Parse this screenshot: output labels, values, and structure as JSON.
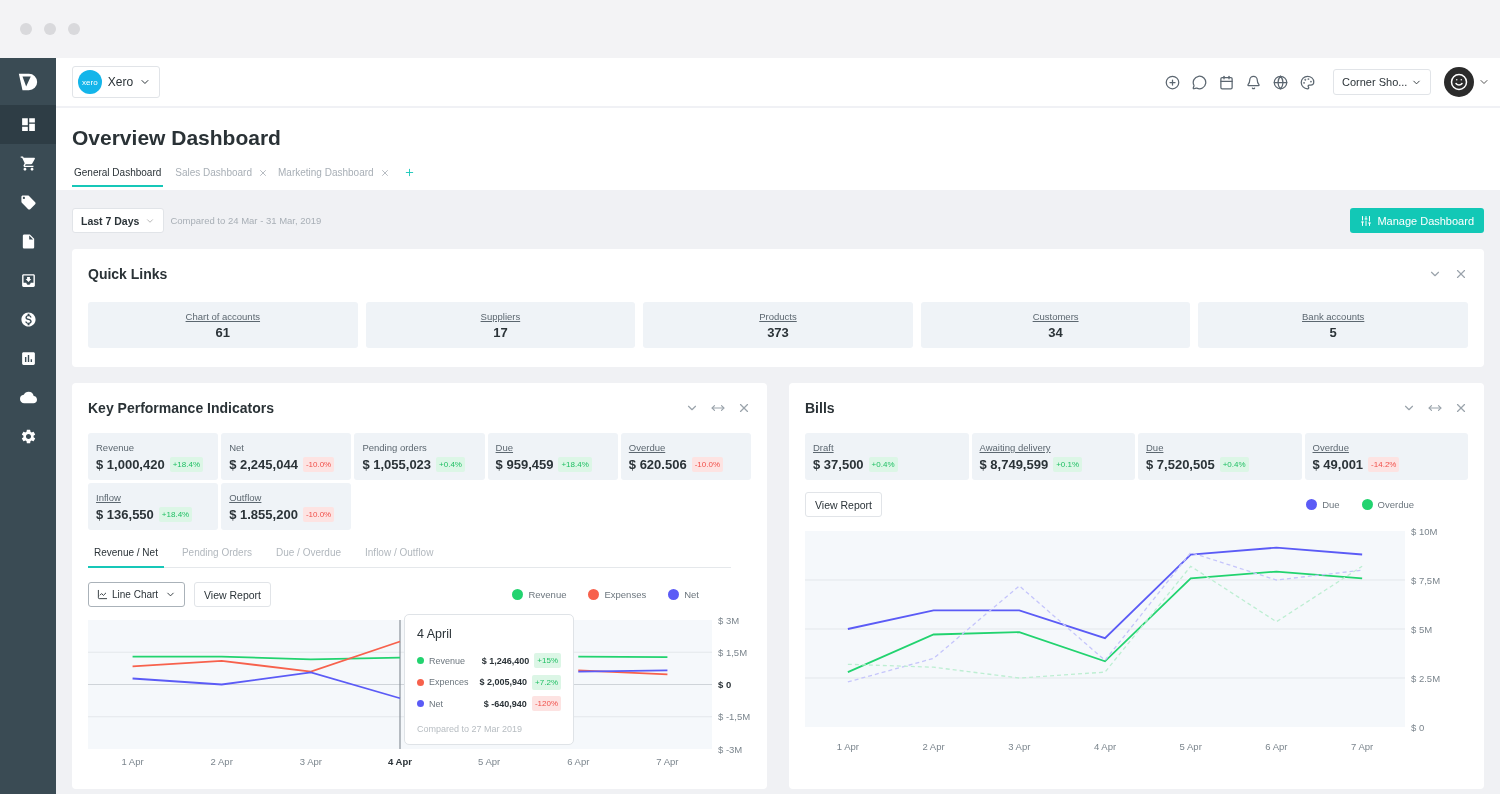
{
  "sidebar": {
    "items": [
      {
        "kind": "dashboard",
        "selected": true
      },
      {
        "kind": "cart",
        "selected": false
      },
      {
        "kind": "tag",
        "selected": false
      },
      {
        "kind": "file",
        "selected": false
      },
      {
        "kind": "inbox",
        "selected": false
      },
      {
        "kind": "money",
        "selected": false
      },
      {
        "kind": "report",
        "selected": false
      },
      {
        "kind": "cloud",
        "selected": false
      },
      {
        "kind": "settings",
        "selected": false
      }
    ]
  },
  "topbar": {
    "org": {
      "logo": "xero",
      "name": "Xero"
    },
    "shop": "Corner Sho..."
  },
  "page": {
    "title": "Overview Dashboard",
    "tabs": [
      {
        "label": "General Dashboard",
        "selected": true,
        "closable": false
      },
      {
        "label": "Sales Dashboard",
        "selected": false,
        "closable": true
      },
      {
        "label": "Marketing Dashboard",
        "selected": false,
        "closable": true
      }
    ]
  },
  "filter": {
    "period": "Last 7 Days",
    "compared": "Compared to 24 Mar - 31 Mar, 2019",
    "action": "Manage Dashboard"
  },
  "quick_links": {
    "title": "Quick Links",
    "items": [
      {
        "label": "Chart of accounts",
        "value": "61"
      },
      {
        "label": "Suppliers",
        "value": "17"
      },
      {
        "label": "Products",
        "value": "373"
      },
      {
        "label": "Customers",
        "value": "34"
      },
      {
        "label": "Bank accounts",
        "value": "5"
      }
    ]
  },
  "kpi": {
    "title": "Key Performance Indicators",
    "stats": [
      {
        "label": "Revenue",
        "link": false,
        "value": "$ 1,000,420",
        "change": "+18.4%",
        "positive": true
      },
      {
        "label": "Net",
        "link": false,
        "value": "$ 2,245,044",
        "change": "-10.0%",
        "positive": false
      },
      {
        "label": "Pending orders",
        "link": false,
        "value": "$ 1,055,023",
        "change": "+0.4%",
        "positive": true
      },
      {
        "label": "Due",
        "link": true,
        "value": "$ 959,459",
        "change": "+18.4%",
        "positive": true
      },
      {
        "label": "Overdue",
        "link": true,
        "value": "$ 620.506",
        "change": "-10.0%",
        "positive": false
      },
      {
        "label": "Inflow",
        "link": true,
        "value": "$ 136,550",
        "change": "+18.4%",
        "positive": true
      },
      {
        "label": "Outflow",
        "link": true,
        "value": "$ 1.855,200",
        "change": "-10.0%",
        "positive": false
      }
    ],
    "tabs": [
      {
        "label": "Revenue / Net",
        "selected": true
      },
      {
        "label": "Pending Orders",
        "selected": false
      },
      {
        "label": "Due / Overdue",
        "selected": false
      },
      {
        "label": "Inflow / Outflow",
        "selected": false
      }
    ],
    "chart_type": "Line Chart",
    "report": "View Report",
    "tooltip": {
      "title": "4 April",
      "rows": [
        {
          "name": "Revenue",
          "color": "#22d36f",
          "value": "$ 1,246,400",
          "change": "+15%",
          "positive": true
        },
        {
          "name": "Expences",
          "color": "#f7614c",
          "value": "$ 2,005,940",
          "change": "+7.2%",
          "positive": true
        },
        {
          "name": "Net",
          "color": "#5b5bf6",
          "value": "$ -640,940",
          "change": "-120%",
          "positive": false
        }
      ],
      "note": "Compared to 27 Mar 2019"
    },
    "chart_data": {
      "type": "line",
      "categories": [
        "1 Apr",
        "2 Apr",
        "3 Apr",
        "4 Apr",
        "5 Apr",
        "6 Apr",
        "7 Apr"
      ],
      "series": [
        {
          "name": "Revenue",
          "color": "#22d36f",
          "values": [
            1.3,
            1.3,
            1.17,
            1.25,
            null,
            1.3,
            1.27
          ]
        },
        {
          "name": "Expenses",
          "color": "#f7614c",
          "values": [
            0.84,
            1.1,
            0.6,
            2.0,
            null,
            0.66,
            0.47
          ]
        },
        {
          "name": "Net",
          "color": "#5b5bf6",
          "values": [
            0.28,
            0,
            0.56,
            -0.64,
            null,
            0.6,
            0.66
          ]
        }
      ],
      "ylim": [
        -3,
        3
      ],
      "grid": true,
      "yticks": [
        {
          "value": 3,
          "label": "$ 3M"
        },
        {
          "value": 1.5,
          "label": "$ 1,5M"
        },
        {
          "value": 0,
          "label": "$ 0"
        },
        {
          "value": -1.5,
          "label": "$ -1,5M"
        },
        {
          "value": -3,
          "label": "$ -3M"
        }
      ],
      "ref_lines": [
        {
          "axis": "x",
          "value": "4 Apr"
        }
      ]
    }
  },
  "bills": {
    "title": "Bills",
    "stats": [
      {
        "label": "Draft",
        "link": true,
        "value": "$ 37,500",
        "change": "+0.4%",
        "positive": true
      },
      {
        "label": "Awaiting delivery",
        "link": true,
        "value": "$ 8,749,599",
        "change": "+0.1%",
        "positive": true
      },
      {
        "label": "Due",
        "link": true,
        "value": "$ 7,520,505",
        "change": "+0.4%",
        "positive": true
      },
      {
        "label": "Overdue",
        "link": true,
        "value": "$ 49,001",
        "change": "-14.2%",
        "positive": false
      }
    ],
    "report": "View Report",
    "chart_data": {
      "type": "line",
      "categories": [
        "1 Apr",
        "2 Apr",
        "3 Apr",
        "4 Apr",
        "5 Apr",
        "6 Apr",
        "7 Apr"
      ],
      "series": [
        {
          "name": "Due",
          "color": "#5b5bf6",
          "values": [
            5,
            5.95,
            5.95,
            4.53,
            8.8,
            9.15,
            8.8
          ]
        },
        {
          "name": "Overdue",
          "color": "#22d36f",
          "values": [
            2.8,
            4.72,
            4.84,
            3.35,
            7.58,
            7.93,
            7.58
          ]
        },
        {
          "color": "#c5c5fb",
          "line_style": "dashed",
          "values": [
            2.3,
            3.5,
            7.2,
            3.4,
            8.9,
            7.5,
            8.0
          ]
        },
        {
          "color": "#bdeed2",
          "line_style": "dashed",
          "values": [
            3.2,
            3.05,
            2.5,
            2.8,
            8.2,
            5.37,
            8.2
          ]
        }
      ],
      "ylim": [
        0,
        10
      ],
      "grid": true,
      "yticks": [
        {
          "value": 10,
          "label": "$ 10M"
        },
        {
          "value": 7.5,
          "label": "$ 7,5M"
        },
        {
          "value": 5,
          "label": "$ 5M"
        },
        {
          "value": 2.5,
          "label": "$ 2.5M"
        },
        {
          "value": 0,
          "label": "$ 0"
        }
      ]
    }
  }
}
